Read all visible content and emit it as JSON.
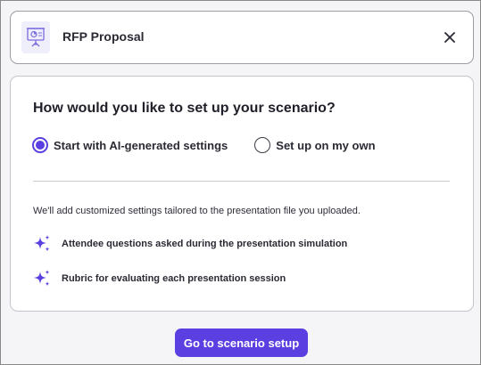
{
  "header": {
    "title": "RFP Proposal",
    "file_icon": "presentation-icon",
    "close_icon": "close-icon"
  },
  "setup": {
    "question": "How would you like to set up your scenario?",
    "options": [
      {
        "label": "Start with AI-generated settings",
        "selected": true
      },
      {
        "label": "Set up on my own",
        "selected": false
      }
    ],
    "description": "We'll add customized settings tailored to the presentation file you uploaded.",
    "features": [
      {
        "icon": "sparkle-icon",
        "label": "Attendee questions asked during the presentation simulation"
      },
      {
        "icon": "sparkle-icon",
        "label": "Rubric for evaluating each presentation session"
      }
    ]
  },
  "cta": {
    "label": "Go to scenario setup"
  },
  "colors": {
    "accent": "#5b3fe0",
    "background": "#f5f5f7",
    "card": "#ffffff"
  }
}
